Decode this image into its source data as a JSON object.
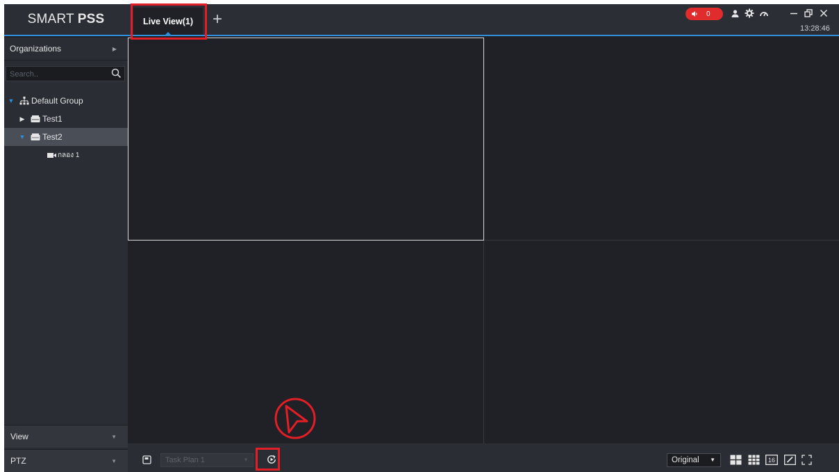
{
  "app": {
    "brand_light": "SMART",
    "brand_bold": "PSS"
  },
  "tabs": [
    {
      "label": "Live View(1)"
    }
  ],
  "add_tab_glyph": "+",
  "alarm": {
    "count": "0"
  },
  "clock": "13:28:46",
  "sidebar": {
    "organizations_label": "Organizations",
    "search_placeholder": "Search..",
    "tree": [
      {
        "label": "Default Group",
        "icon": "group-icon",
        "expanded": true
      },
      {
        "label": "Test1",
        "icon": "device-icon",
        "expanded": false
      },
      {
        "label": "Test2",
        "icon": "device-icon",
        "expanded": true,
        "selected": true
      },
      {
        "label": "กลอง 1",
        "icon": "camera-icon"
      }
    ],
    "view_label": "View",
    "ptz_label": "PTZ"
  },
  "toolbar": {
    "task_plan": "Task Plan 1",
    "stream_select": "Original",
    "split16_label": "16"
  },
  "colors": {
    "accent": "#2f8fd8",
    "alarm": "#e02c2c",
    "annotation": "#e21e26"
  }
}
